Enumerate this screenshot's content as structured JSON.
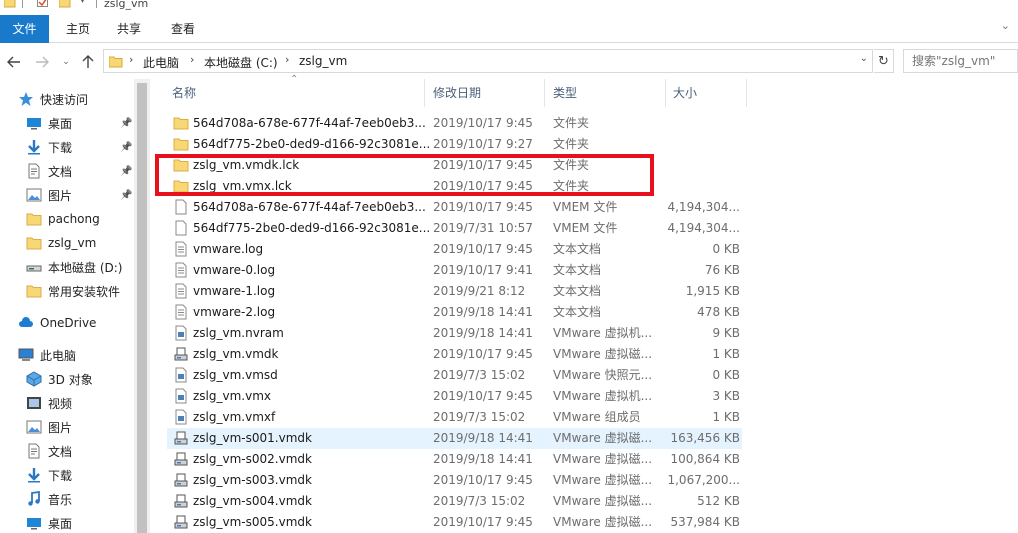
{
  "window": {
    "title": "zslg_vm"
  },
  "ribbon": {
    "tabs": [
      "文件",
      "主页",
      "共享",
      "查看"
    ]
  },
  "address": {
    "crumbs": [
      "此电脑",
      "本地磁盘 (C:)",
      "zslg_vm"
    ]
  },
  "search": {
    "placeholder": "搜索\"zslg_vm\""
  },
  "sidebar": {
    "items": [
      {
        "label": "快速访问",
        "icon": "star-icon",
        "indent": 0
      },
      {
        "label": "桌面",
        "icon": "desktop-icon",
        "indent": 1,
        "pinned": true
      },
      {
        "label": "下载",
        "icon": "download-icon",
        "indent": 1,
        "pinned": true
      },
      {
        "label": "文档",
        "icon": "document-icon",
        "indent": 1,
        "pinned": true
      },
      {
        "label": "图片",
        "icon": "picture-icon",
        "indent": 1,
        "pinned": true
      },
      {
        "label": "pachong",
        "icon": "folder-icon",
        "indent": 1
      },
      {
        "label": "zslg_vm",
        "icon": "folder-icon",
        "indent": 1
      },
      {
        "label": "本地磁盘 (D:)",
        "icon": "drive-icon",
        "indent": 1
      },
      {
        "label": "常用安装软件",
        "icon": "folder-icon",
        "indent": 1
      },
      {
        "label": "OneDrive",
        "icon": "cloud-icon",
        "indent": 0
      },
      {
        "label": "此电脑",
        "icon": "computer-icon",
        "indent": 0
      },
      {
        "label": "3D 对象",
        "icon": "3d-objects-icon",
        "indent": 1
      },
      {
        "label": "视频",
        "icon": "video-icon",
        "indent": 1
      },
      {
        "label": "图片",
        "icon": "picture-icon",
        "indent": 1
      },
      {
        "label": "文档",
        "icon": "document-icon",
        "indent": 1
      },
      {
        "label": "下载",
        "icon": "download-icon",
        "indent": 1
      },
      {
        "label": "音乐",
        "icon": "music-icon",
        "indent": 1
      },
      {
        "label": "桌面",
        "icon": "desktop-icon",
        "indent": 1
      }
    ]
  },
  "columns": {
    "name": "名称",
    "date": "修改日期",
    "type": "类型",
    "size": "大小"
  },
  "files": [
    {
      "name": "564d708a-678e-677f-44af-7eeb0eb3...",
      "date": "2019/10/17 9:45",
      "type": "文件夹",
      "size": "",
      "icon": "folder-icon"
    },
    {
      "name": "564df775-2be0-ded9-d166-92c3081e...",
      "date": "2019/10/17 9:27",
      "type": "文件夹",
      "size": "",
      "icon": "folder-icon"
    },
    {
      "name": "zslg_vm.vmdk.lck",
      "date": "2019/10/17 9:45",
      "type": "文件夹",
      "size": "",
      "icon": "folder-icon"
    },
    {
      "name": "zslg_vm.vmx.lck",
      "date": "2019/10/17 9:45",
      "type": "文件夹",
      "size": "",
      "icon": "folder-icon"
    },
    {
      "name": "564d708a-678e-677f-44af-7eeb0eb3...",
      "date": "2019/10/17 9:45",
      "type": "VMEM 文件",
      "size": "4,194,304...",
      "icon": "file-icon"
    },
    {
      "name": "564df775-2be0-ded9-d166-92c3081e...",
      "date": "2019/7/31 10:57",
      "type": "VMEM 文件",
      "size": "4,194,304...",
      "icon": "file-icon"
    },
    {
      "name": "vmware.log",
      "date": "2019/10/17 9:45",
      "type": "文本文档",
      "size": "0 KB",
      "icon": "text-file-icon"
    },
    {
      "name": "vmware-0.log",
      "date": "2019/10/17 9:41",
      "type": "文本文档",
      "size": "76 KB",
      "icon": "text-file-icon"
    },
    {
      "name": "vmware-1.log",
      "date": "2019/9/21 8:12",
      "type": "文本文档",
      "size": "1,915 KB",
      "icon": "text-file-icon"
    },
    {
      "name": "vmware-2.log",
      "date": "2019/9/18 14:41",
      "type": "文本文档",
      "size": "478 KB",
      "icon": "text-file-icon"
    },
    {
      "name": "zslg_vm.nvram",
      "date": "2019/9/18 14:41",
      "type": "VMware 虚拟机...",
      "size": "9 KB",
      "icon": "vm-config-icon"
    },
    {
      "name": "zslg_vm.vmdk",
      "date": "2019/10/17 9:45",
      "type": "VMware 虚拟磁...",
      "size": "1 KB",
      "icon": "virtual-disk-icon"
    },
    {
      "name": "zslg_vm.vmsd",
      "date": "2019/7/3 15:02",
      "type": "VMware 快照元...",
      "size": "0 KB",
      "icon": "vm-config-icon"
    },
    {
      "name": "zslg_vm.vmx",
      "date": "2019/10/17 9:45",
      "type": "VMware 虚拟机...",
      "size": "3 KB",
      "icon": "vm-config-icon"
    },
    {
      "name": "zslg_vm.vmxf",
      "date": "2019/7/3 15:02",
      "type": "VMware 组成员",
      "size": "1 KB",
      "icon": "vm-config-icon"
    },
    {
      "name": "zslg_vm-s001.vmdk",
      "date": "2019/9/18 14:41",
      "type": "VMware 虚拟磁...",
      "size": "163,456 KB",
      "icon": "virtual-disk-icon",
      "selected": true
    },
    {
      "name": "zslg_vm-s002.vmdk",
      "date": "2019/9/18 14:41",
      "type": "VMware 虚拟磁...",
      "size": "100,864 KB",
      "icon": "virtual-disk-icon"
    },
    {
      "name": "zslg_vm-s003.vmdk",
      "date": "2019/10/17 9:45",
      "type": "VMware 虚拟磁...",
      "size": "1,067,200...",
      "icon": "virtual-disk-icon"
    },
    {
      "name": "zslg_vm-s004.vmdk",
      "date": "2019/7/3 15:02",
      "type": "VMware 虚拟磁...",
      "size": "512 KB",
      "icon": "virtual-disk-icon"
    },
    {
      "name": "zslg_vm-s005.vmdk",
      "date": "2019/10/17 9:45",
      "type": "VMware 虚拟磁...",
      "size": "537,984 KB",
      "icon": "virtual-disk-icon"
    }
  ],
  "colors": {
    "accent": "#1979ca",
    "highlight_box": "#e8101c",
    "selected_row": "#e5f3ff",
    "folder": "#f8d775"
  }
}
